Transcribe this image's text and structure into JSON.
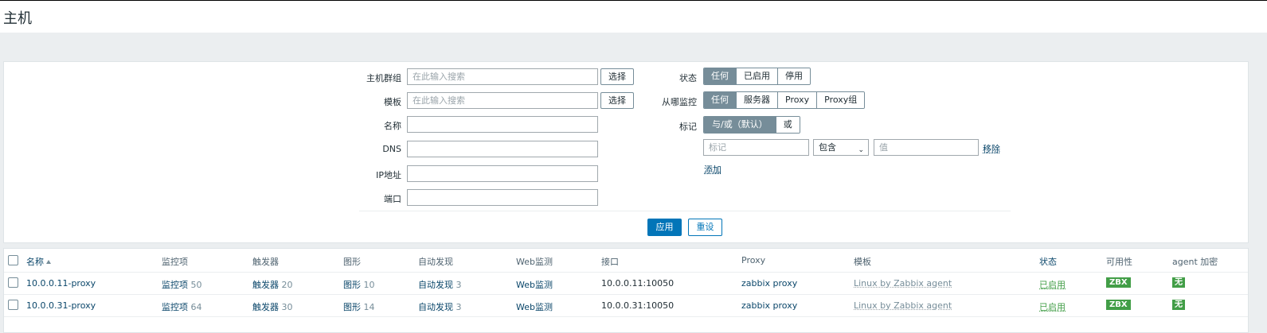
{
  "page": {
    "title": "主机"
  },
  "filter": {
    "host_groups": {
      "label": "主机群组",
      "placeholder": "在此输入搜索",
      "select_label": "选择"
    },
    "templates": {
      "label": "模板",
      "placeholder": "在此输入搜索",
      "select_label": "选择"
    },
    "name": {
      "label": "名称",
      "value": ""
    },
    "dns": {
      "label": "DNS",
      "value": ""
    },
    "ip": {
      "label": "IP地址",
      "value": ""
    },
    "port": {
      "label": "端口",
      "value": ""
    },
    "status": {
      "label": "状态",
      "options": [
        "任何",
        "已启用",
        "停用"
      ],
      "selected": "任何"
    },
    "monitored_by": {
      "label": "从哪监控",
      "options": [
        "任何",
        "服务器",
        "Proxy",
        "Proxy组"
      ],
      "selected": "任何"
    },
    "tags": {
      "label": "标记",
      "options": [
        "与/或（默认）",
        "或"
      ],
      "selected": "与/或（默认）",
      "tag_placeholder": "标记",
      "operator": "包含",
      "value_placeholder": "值",
      "remove_label": "移除",
      "add_label": "添加"
    },
    "apply_label": "应用",
    "reset_label": "重设"
  },
  "table": {
    "headers": {
      "name": "名称",
      "items": "监控项",
      "triggers": "触发器",
      "graphs": "图形",
      "discovery": "自动发现",
      "web": "Web监测",
      "interface": "接口",
      "proxy": "Proxy",
      "templates": "模板",
      "status": "状态",
      "availability": "可用性",
      "encryption": "agent 加密"
    },
    "rows": [
      {
        "name": "10.0.0.11-proxy",
        "items_label": "监控项",
        "items_count": "50",
        "triggers_label": "触发器",
        "triggers_count": "20",
        "graphs_label": "图形",
        "graphs_count": "10",
        "discovery_label": "自动发现",
        "discovery_count": "3",
        "web": "Web监测",
        "interface": "10.0.0.11:10050",
        "proxy": "zabbix proxy",
        "template": "Linux by Zabbix agent",
        "status": "已启用",
        "availability": "ZBX",
        "encryption": "无"
      },
      {
        "name": "10.0.0.31-proxy",
        "items_label": "监控项",
        "items_count": "64",
        "triggers_label": "触发器",
        "triggers_count": "30",
        "graphs_label": "图形",
        "graphs_count": "14",
        "discovery_label": "自动发现",
        "discovery_count": "3",
        "web": "Web监测",
        "interface": "10.0.0.31:10050",
        "proxy": "zabbix proxy",
        "template": "Linux by Zabbix agent",
        "status": "已启用",
        "availability": "ZBX",
        "encryption": "无"
      }
    ]
  },
  "colors": {
    "primary": "#0275b8",
    "link": "#0a466a",
    "enabled": "#429e47",
    "segment_active": "#768d99"
  }
}
